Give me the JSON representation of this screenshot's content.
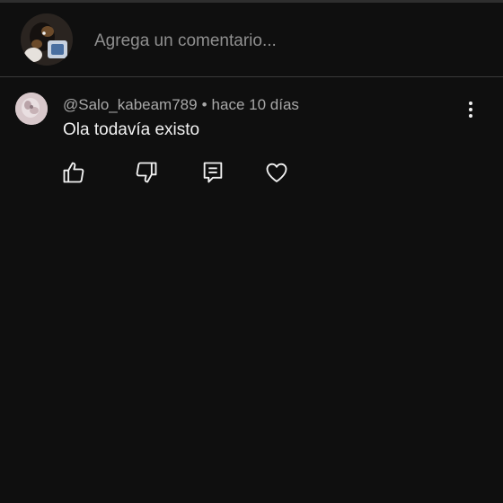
{
  "composer": {
    "placeholder": "Agrega un comentario...",
    "avatar_icon": "user-avatar-dog-photo"
  },
  "comment": {
    "author": "@Salo_kabeam789",
    "separator": "•",
    "timestamp": "hace 10 días",
    "text": "Ola todavía existo",
    "avatar_icon": "user-avatar-pale-photo",
    "actions": {
      "like_icon": "thumbs-up-icon",
      "dislike_icon": "thumbs-down-icon",
      "reply_icon": "reply-icon",
      "heart_icon": "heart-icon",
      "more_icon": "more-vertical-icon"
    }
  },
  "colors": {
    "background": "#0f0f0f",
    "primary_text": "#f1f1f1",
    "secondary_text": "#a8a8a8",
    "divider": "#3a3a3a"
  }
}
